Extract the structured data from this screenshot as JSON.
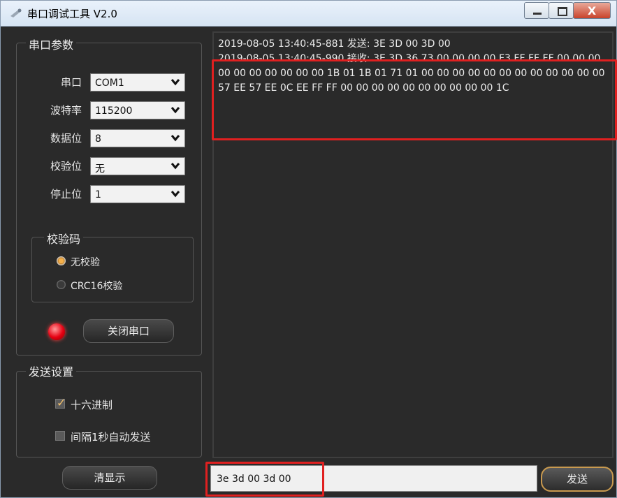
{
  "window": {
    "title": "串口调试工具 V2.0",
    "close_glyph": "X"
  },
  "serial_params": {
    "legend": "串口参数",
    "fields": [
      {
        "label": "串口",
        "value": "COM1"
      },
      {
        "label": "波特率",
        "value": "115200"
      },
      {
        "label": "数据位",
        "value": "8"
      },
      {
        "label": "校验位",
        "value": "无"
      },
      {
        "label": "停止位",
        "value": "1"
      }
    ],
    "checksum": {
      "legend": "校验码",
      "options": [
        {
          "label": "无校验",
          "selected": true
        },
        {
          "label": "CRC16校验",
          "selected": false
        }
      ]
    },
    "port_status_color": "#e60012",
    "close_port_label": "关闭串口"
  },
  "send_settings": {
    "legend": "发送设置",
    "hex_label": "十六进制",
    "hex_checked": true,
    "auto_send_label": "间隔1秒自动发送",
    "auto_send_checked": false
  },
  "clear_label": "清显示",
  "log": [
    {
      "text": "2019-08-05  13:40:45-881  发送:  3E 3D 00 3D 00"
    },
    {
      "text": "2019-08-05  13:40:45-990  接收:  3E 3D 36 73 00 00 00 00 F3 FF FF FF 00 00 00 00 00 00 00 00 00 00 1B 01 1B 01 71 01 00 00 00 00 00 00 00 00 00 00 00 00 57 EE 57 EE 0C EE FF FF 00 00 00 00 00 00 00 00 00 00 1C"
    }
  ],
  "send_input": {
    "value": "3e 3d 00 3d 00"
  },
  "send_label": "发送",
  "highlight_color": "#e02020"
}
